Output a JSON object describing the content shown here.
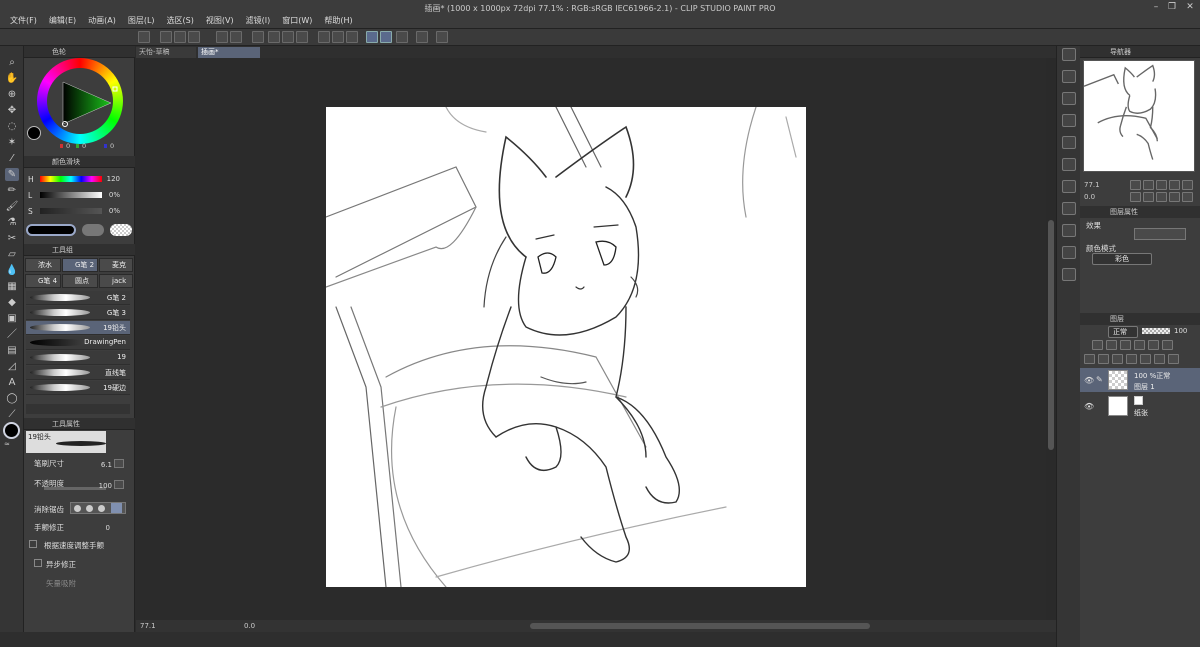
{
  "window": {
    "title": "插画* (1000 x 1000px 72dpi 77.1% : RGB:sRGB IEC61966-2.1) - CLIP STUDIO PAINT PRO",
    "menus": [
      "文件(F)",
      "编辑(E)",
      "动画(A)",
      "图层(L)",
      "选区(S)",
      "视图(V)",
      "滤镜(I)",
      "窗口(W)",
      "帮助(H)"
    ]
  },
  "tabs": [
    {
      "label": "天怡-草稿"
    },
    {
      "label": "插画*"
    }
  ],
  "color_wheel": {
    "panel_title": "色轮",
    "rgb_values": [
      "0",
      "0",
      "0"
    ],
    "hue_color": "#1ac41a"
  },
  "color_slider": {
    "panel_title": "颜色滑块",
    "h_label": "H",
    "h_value": "120",
    "l_label": "L",
    "l_value": "0%",
    "s_label": "S",
    "s_value": "0%"
  },
  "sub_tool": {
    "panel_title": "工具组",
    "tabs": [
      "浓水",
      "G笔 2",
      "麦克",
      "G笔 4",
      "圆点",
      "jack"
    ],
    "brushes": [
      "G笔 2",
      "G笔 3",
      "19铅头",
      "DrawingPen",
      "19",
      "直线笔",
      "19硬边"
    ],
    "selected_brush": "19铅头"
  },
  "tool_property": {
    "panel_title": "工具属性",
    "brush_name": "19铅头",
    "brush_size_label": "笔刷尺寸",
    "brush_size_value": "6.1",
    "opacity_label": "不透明度",
    "opacity_value": "100",
    "antialias_label": "消除锯齿",
    "stabilization_label": "手颤修正",
    "stabilization_value": "0",
    "speed_label": "根据速度调整手颤",
    "post_correction_label": "异步修正",
    "vector_label": "矢量吸附"
  },
  "navigator": {
    "panel_title": "导航器",
    "zoom": "77.1",
    "angle": "0.0"
  },
  "layer_property": {
    "panel_title": "图层属性",
    "effect_label": "效果",
    "color_mode_label": "颜色模式",
    "color_mode_value": "彩色"
  },
  "layers": {
    "panel_title": "图层",
    "blend_mode": "正常",
    "opacity": "100",
    "items": [
      {
        "opacity_mode": "100 %正常",
        "name": "图层 1"
      },
      {
        "opacity_mode": "",
        "name": "纸张"
      }
    ]
  },
  "status": {
    "zoom": "77.1",
    "angle": "0.0"
  }
}
